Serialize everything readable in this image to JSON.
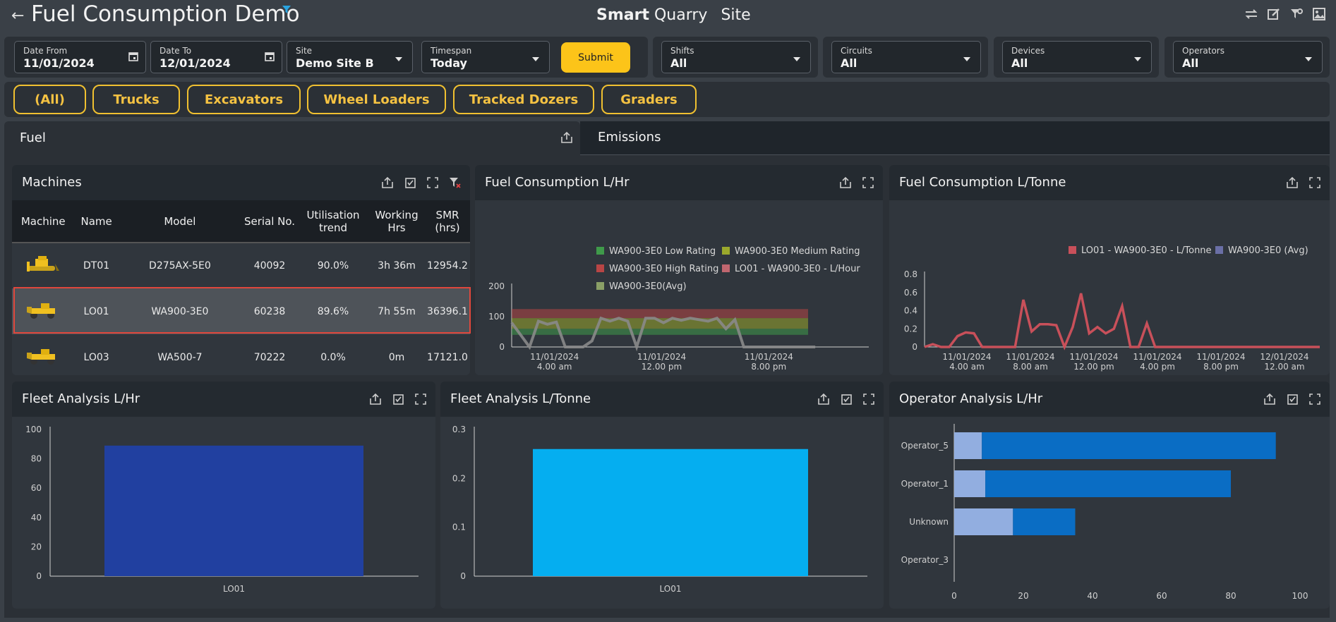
{
  "header": {
    "title": "Fuel Consumption Demo",
    "brand_1": "Smart",
    "brand_2": "Quarry",
    "brand_3": "Site"
  },
  "filters": {
    "date_from": {
      "label": "Date From",
      "value": "11/01/2024"
    },
    "date_to": {
      "label": "Date To",
      "value": "12/01/2024"
    },
    "site": {
      "label": "Site",
      "value": "Demo Site B"
    },
    "timespan": {
      "label": "Timespan",
      "value": "Today"
    },
    "submit_label": "Submit",
    "shifts": {
      "label": "Shifts",
      "value": "All"
    },
    "circuits": {
      "label": "Circuits",
      "value": "All"
    },
    "devices": {
      "label": "Devices",
      "value": "All"
    },
    "operators": {
      "label": "Operators",
      "value": "All"
    }
  },
  "categories": [
    "(All)",
    "Trucks",
    "Excavators",
    "Wheel Loaders",
    "Tracked Dozers",
    "Graders"
  ],
  "tabs": {
    "fuel": "Fuel",
    "emissions": "Emissions"
  },
  "machines": {
    "title": "Machines",
    "columns": [
      "Machine",
      "Name",
      "Model",
      "Serial No.",
      "Utilisation trend",
      "Working Hrs",
      "SMR (hrs)"
    ],
    "rows": [
      {
        "name": "DT01",
        "model": "D275AX-5E0",
        "serial": "40092",
        "util": "90.0%",
        "hrs": "3h 36m",
        "smr": "12954.2"
      },
      {
        "name": "LO01",
        "model": "WA900-3E0",
        "serial": "60238",
        "util": "89.6%",
        "hrs": "7h 55m",
        "smr": "36396.1"
      },
      {
        "name": "LO03",
        "model": "WA500-7",
        "serial": "70222",
        "util": "0.0%",
        "hrs": "0m",
        "smr": "17121.0"
      }
    ]
  },
  "colors": {
    "accent": "#fcc419",
    "low_rating": "#3f9a4a",
    "medium_rating": "#9aa82c",
    "high_rating": "#b84545",
    "lhour_series": "#c0666f",
    "avg": "#8a9f66",
    "ltonne_series": "#c8505a",
    "ltonne_avg": "#6a6fa6",
    "fleet_lhr": "#2140a0",
    "fleet_lt": "#05aef0",
    "op_light": "#92aee0",
    "op_dark": "#0a6dc4"
  },
  "chart_data": [
    {
      "type": "line",
      "title": "Fuel Consumption L/Hr",
      "legend": [
        "WA900-3E0 Low Rating",
        "WA900-3E0 Medium Rating",
        "WA900-3E0 High Rating",
        "LO01 - WA900-3E0 - L/Hour",
        "WA900-3E0(Avg)"
      ],
      "x_ticks": [
        [
          "11/01/2024",
          "4.00 am"
        ],
        [
          "11/01/2024",
          "12.00 pm"
        ],
        [
          "11/01/2024",
          "8.00 pm"
        ]
      ],
      "y_ticks": [
        0,
        100,
        200
      ],
      "ylim": [
        0,
        200
      ],
      "bands": {
        "low": [
          40,
          60
        ],
        "medium": [
          60,
          95
        ],
        "high": [
          95,
          125
        ]
      },
      "x_hours": [
        0,
        1,
        1.5,
        2,
        2.5,
        3,
        3.5,
        4,
        4.5,
        5,
        5.5,
        6,
        6.5,
        7,
        7.5,
        8,
        8.5,
        9,
        9.5,
        10,
        10.5,
        11,
        11.5,
        12,
        12.5,
        13,
        13.5,
        14,
        14.5,
        15,
        15.5,
        16,
        16.5,
        17
      ],
      "values": [
        80,
        0,
        85,
        75,
        82,
        0,
        0,
        0,
        20,
        95,
        85,
        95,
        85,
        0,
        95,
        95,
        80,
        95,
        88,
        95,
        90,
        85,
        95,
        60,
        90,
        0,
        0,
        0,
        0,
        0,
        0,
        0,
        0,
        0
      ]
    },
    {
      "type": "line",
      "title": "Fuel Consumption L/Tonne",
      "legend": [
        "LO01 - WA900-3E0 - L/Tonne",
        "WA900-3E0 (Avg)"
      ],
      "x_ticks": [
        [
          "11/01/2024",
          "4.00 am"
        ],
        [
          "11/01/2024",
          "8.00 am"
        ],
        [
          "11/01/2024",
          "12.00 pm"
        ],
        [
          "11/01/2024",
          "4.00 pm"
        ],
        [
          "11/01/2024",
          "8.00 pm"
        ],
        [
          "12/01/2024",
          "12.00 am"
        ]
      ],
      "y_ticks": [
        0,
        0.2,
        0.4,
        0.6,
        0.8
      ],
      "ylim": [
        0,
        0.8
      ],
      "x_hours": [
        0,
        0.5,
        1,
        1.5,
        2,
        2.5,
        3,
        3.5,
        4,
        4.5,
        5,
        5.5,
        6,
        6.5,
        7,
        7.5,
        8,
        8.5,
        9,
        9.5,
        10,
        10.5,
        11,
        11.5,
        12,
        12.5,
        13,
        13.5,
        14,
        14.5,
        15,
        15.5,
        16,
        16.5,
        17,
        24
      ],
      "values": [
        0,
        0.03,
        0,
        0,
        0.12,
        0.16,
        0.15,
        0,
        0,
        0,
        0,
        0,
        0.52,
        0.17,
        0.25,
        0.25,
        0.24,
        0,
        0.22,
        0.59,
        0.15,
        0.22,
        0.15,
        0.2,
        0.45,
        0,
        0,
        0.26,
        0,
        0,
        0,
        0,
        0,
        0,
        0,
        0
      ]
    },
    {
      "type": "bar",
      "title": "Fleet Analysis L/Hr",
      "categories": [
        "LO01"
      ],
      "values": [
        89
      ],
      "y_ticks": [
        0,
        20,
        40,
        60,
        80,
        100
      ],
      "ylim": [
        0,
        100
      ]
    },
    {
      "type": "bar",
      "title": "Fleet Analysis L/Tonne",
      "categories": [
        "LO01"
      ],
      "values": [
        0.26
      ],
      "y_ticks": [
        0,
        0.1,
        0.2,
        0.3
      ],
      "ylim": [
        0,
        0.3
      ]
    },
    {
      "type": "bar",
      "title": "Operator Analysis L/Hr",
      "categories": [
        "Operator_5",
        "Operator_1",
        "Unknown",
        "Operator_3"
      ],
      "series": [
        {
          "values": [
            8,
            9,
            17,
            0
          ]
        },
        {
          "values": [
            93,
            80,
            35,
            0
          ]
        }
      ],
      "x_ticks": [
        0,
        20,
        40,
        60,
        80,
        100
      ],
      "xlim": [
        0,
        100
      ]
    }
  ]
}
